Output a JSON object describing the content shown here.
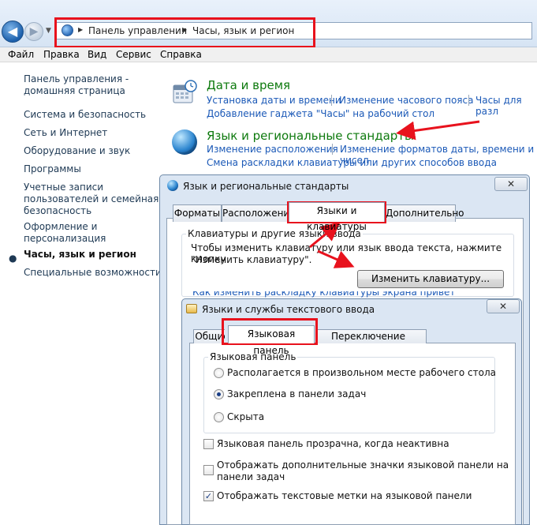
{
  "breadcrumb": {
    "root": "Панель управления",
    "current": "Часы, язык и регион"
  },
  "menu": [
    "Файл",
    "Правка",
    "Вид",
    "Сервис",
    "Справка"
  ],
  "left_nav": {
    "home_line1": "Панель управления -",
    "home_line2": "домашняя страница",
    "items": [
      "Система и безопасность",
      "Сеть и Интернет",
      "Оборудование и звук",
      "Программы"
    ],
    "accounts": [
      "Учетные записи",
      "пользователей и семейная",
      "безопасность"
    ],
    "personalization": [
      "Оформление и",
      "персонализация"
    ],
    "current": "Часы, язык и регион",
    "accessibility": "Специальные возможности"
  },
  "categories": {
    "datetime": {
      "title": "Дата и время",
      "links": [
        "Установка даты и времени",
        "Изменение часового пояса",
        "Часы для разл"
      ],
      "link2": "Добавление гаджета \"Часы\" на рабочий стол"
    },
    "region": {
      "title": "Язык и региональные стандарты",
      "links": [
        "Изменение расположения",
        "Изменение форматов даты, времени и чисел"
      ],
      "link2": "Смена раскладки клавиатуры или других способов ввода"
    }
  },
  "dialog1": {
    "title": "Язык и региональные стандарты",
    "close": "✕",
    "tabs": [
      "Форматы",
      "Расположение",
      "Языки и клавиатуры",
      "Дополнительно"
    ],
    "group_title": "Клавиатуры и другие языки ввода",
    "desc1": "Чтобы изменить клавиатуру или язык ввода текста, нажмите кнопку",
    "desc2": "\"Изменить клавиатуру\".",
    "button": "Изменить клавиатуру...",
    "partial_link": "Как изменить раскладку клавиатуры экрана приветствия?"
  },
  "dialog2": {
    "title": "Языки и службы текстового ввода",
    "close": "✕",
    "tabs": [
      "Общие",
      "Языковая панель",
      "Переключение клавиатуры"
    ],
    "group_title": "Языковая панель",
    "radios": [
      {
        "label": "Располагается в произвольном месте рабочего стола",
        "checked": false
      },
      {
        "label": "Закреплена в панели задач",
        "checked": true
      },
      {
        "label": "Скрыта",
        "checked": false
      }
    ],
    "checks": [
      {
        "label": "Языковая панель прозрачна, когда неактивна",
        "checked": false
      },
      {
        "label1": "Отображать дополнительные значки языковой панели на",
        "label2": "панели задач",
        "checked": false
      },
      {
        "label": "Отображать текстовые метки на языковой панели",
        "checked": true
      }
    ]
  },
  "colors": {
    "highlight": "#e8121d",
    "link": "#1b59b7",
    "category": "#0e7a0e"
  }
}
